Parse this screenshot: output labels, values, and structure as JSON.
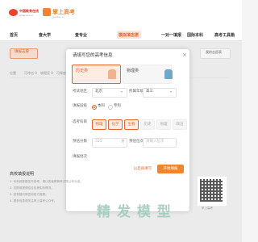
{
  "header": {
    "logo_text": "中国教育在线",
    "logo_sub": "www.eol.cn",
    "brand_text": "掌上高考",
    "brand_sub": "gaokao.cn"
  },
  "nav": {
    "items": [
      "首页",
      "查大学",
      "查专业",
      "模拟填志愿",
      "一对一填报",
      "国际本科",
      "高考工具箱"
    ],
    "active_index": 3
  },
  "toolbar": {
    "left_button": "填报志愿",
    "right_button": "我的志愿表"
  },
  "filters": [
    "位置",
    "可冲击 0",
    "较稳妥 0",
    "可保底 0"
  ],
  "modal": {
    "title": "请填写您的高考信息",
    "subjects": [
      {
        "label": "历史类",
        "selected": true
      },
      {
        "label": "物理类",
        "selected": false
      }
    ],
    "region_label": "考试地区",
    "region_value": "北京",
    "region_right_label": "所属年级",
    "region_right_value": "高三",
    "level_label": "填报层级",
    "levels": [
      {
        "label": "本科",
        "selected": true
      },
      {
        "label": "专科",
        "selected": false
      }
    ],
    "elective_label": "选考科目",
    "electives": [
      {
        "label": "物理",
        "selected": true
      },
      {
        "label": "化学",
        "selected": true
      },
      {
        "label": "生物",
        "selected": true
      },
      {
        "label": "历史",
        "selected": false
      },
      {
        "label": "地理",
        "selected": false
      },
      {
        "label": "政治",
        "selected": false
      }
    ],
    "score_label": "预估分数",
    "score_placeholder": "525",
    "score_unit": "分",
    "rank_label": "预估位次",
    "rank_placeholder": "请输入位次",
    "batch_label": "填报批次",
    "cancel_label": "以后再填写",
    "submit_label": "开始填报"
  },
  "notes": {
    "title": "高校填报说明",
    "items": [
      "1. 本系统数据仅作参考，请以各省教育考试院公布为准。",
      "2. 志愿填报请结合自身实际情况。",
      "3. 如有疑问请咨询官方客服。",
      "4. 更多信息请关注掌上高考公众号。"
    ]
  },
  "qr_caption": "掌上高考",
  "watermark": "精 发 模 型",
  "colors": {
    "accent": "#e8652a",
    "brand": "#f0852d"
  }
}
